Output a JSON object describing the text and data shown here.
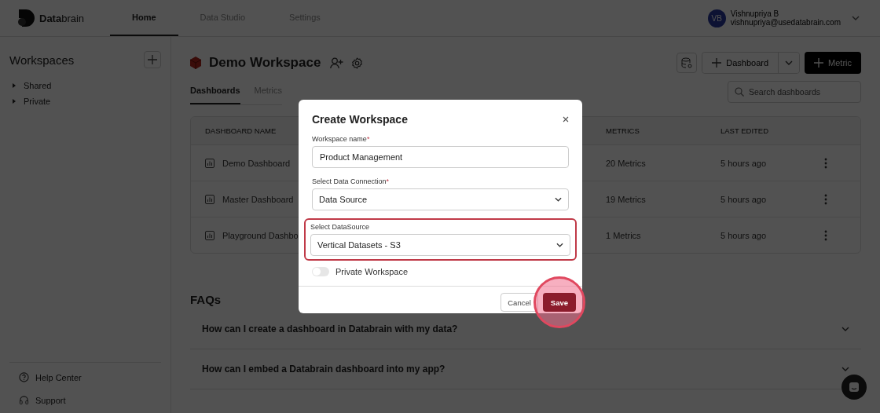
{
  "header": {
    "logo": "**Data**brain",
    "nav": [
      {
        "label": "Home",
        "selected": true
      },
      {
        "label": "Data Studio",
        "selected": false
      },
      {
        "label": "Settings",
        "selected": false
      }
    ],
    "user": {
      "initials": "VB",
      "name": "Vishnupriya B",
      "email": "vishnupriya@usedatabrain.com"
    }
  },
  "sidebar": {
    "title": "Workspaces",
    "items": [
      {
        "label": "Shared",
        "expanded": false
      },
      {
        "label": "Private",
        "expanded": false
      }
    ],
    "footer": [
      {
        "kind": "help",
        "label": "Help Center"
      },
      {
        "kind": "support",
        "label": "Support"
      }
    ]
  },
  "workspace": {
    "title": "Demo Workspace",
    "buttons": [
      {
        "kind": "icon"
      },
      {
        "kind": "split",
        "label": "Dashboard"
      },
      {
        "kind": "primary",
        "label": "Metric"
      }
    ]
  },
  "tabs": [
    {
      "label": "Dashboards",
      "selected": true
    },
    {
      "label": "Metrics",
      "selected": false
    }
  ],
  "search": {
    "placeholder": "Search dashboards"
  },
  "table": {
    "columns": [
      "DASHBOARD NAME",
      "METRICS",
      "LAST EDITED"
    ],
    "rows": [
      {
        "name": "Demo Dashboard",
        "metrics": "20 Metrics",
        "edited": "5 hours ago"
      },
      {
        "name": "Master Dashboard",
        "metrics": "19 Metrics",
        "edited": "5 hours ago"
      },
      {
        "name": "Playground Dashbo",
        "metrics": "1 Metrics",
        "edited": "5 hours ago"
      }
    ]
  },
  "faqs": {
    "title": "FAQs",
    "items": [
      {
        "question": "How can I create a dashboard in Databrain with my data?",
        "expanded": false
      },
      {
        "question": "How can I embed a Databrain dashboard into my app?",
        "expanded": false
      }
    ]
  },
  "modal": {
    "title": "Create Workspace",
    "fields": [
      {
        "kind": "text",
        "label": "Workspace name",
        "required_mark": "*",
        "value": "Product Management",
        "highlighted": false
      },
      {
        "kind": "select",
        "label": "Select Data Connection",
        "required_mark": "*",
        "value": "Data Source",
        "highlighted": false
      },
      {
        "kind": "select",
        "label": "Select DataSource",
        "value": "Vertical Datasets - S3",
        "highlighted": true
      }
    ],
    "toggle": {
      "label": "Private Workspace",
      "on": false
    },
    "buttons": [
      {
        "kind": "secondary",
        "label": "Cancel",
        "highlighted": false
      },
      {
        "kind": "primary",
        "label": "Save",
        "highlighted": true
      }
    ]
  }
}
